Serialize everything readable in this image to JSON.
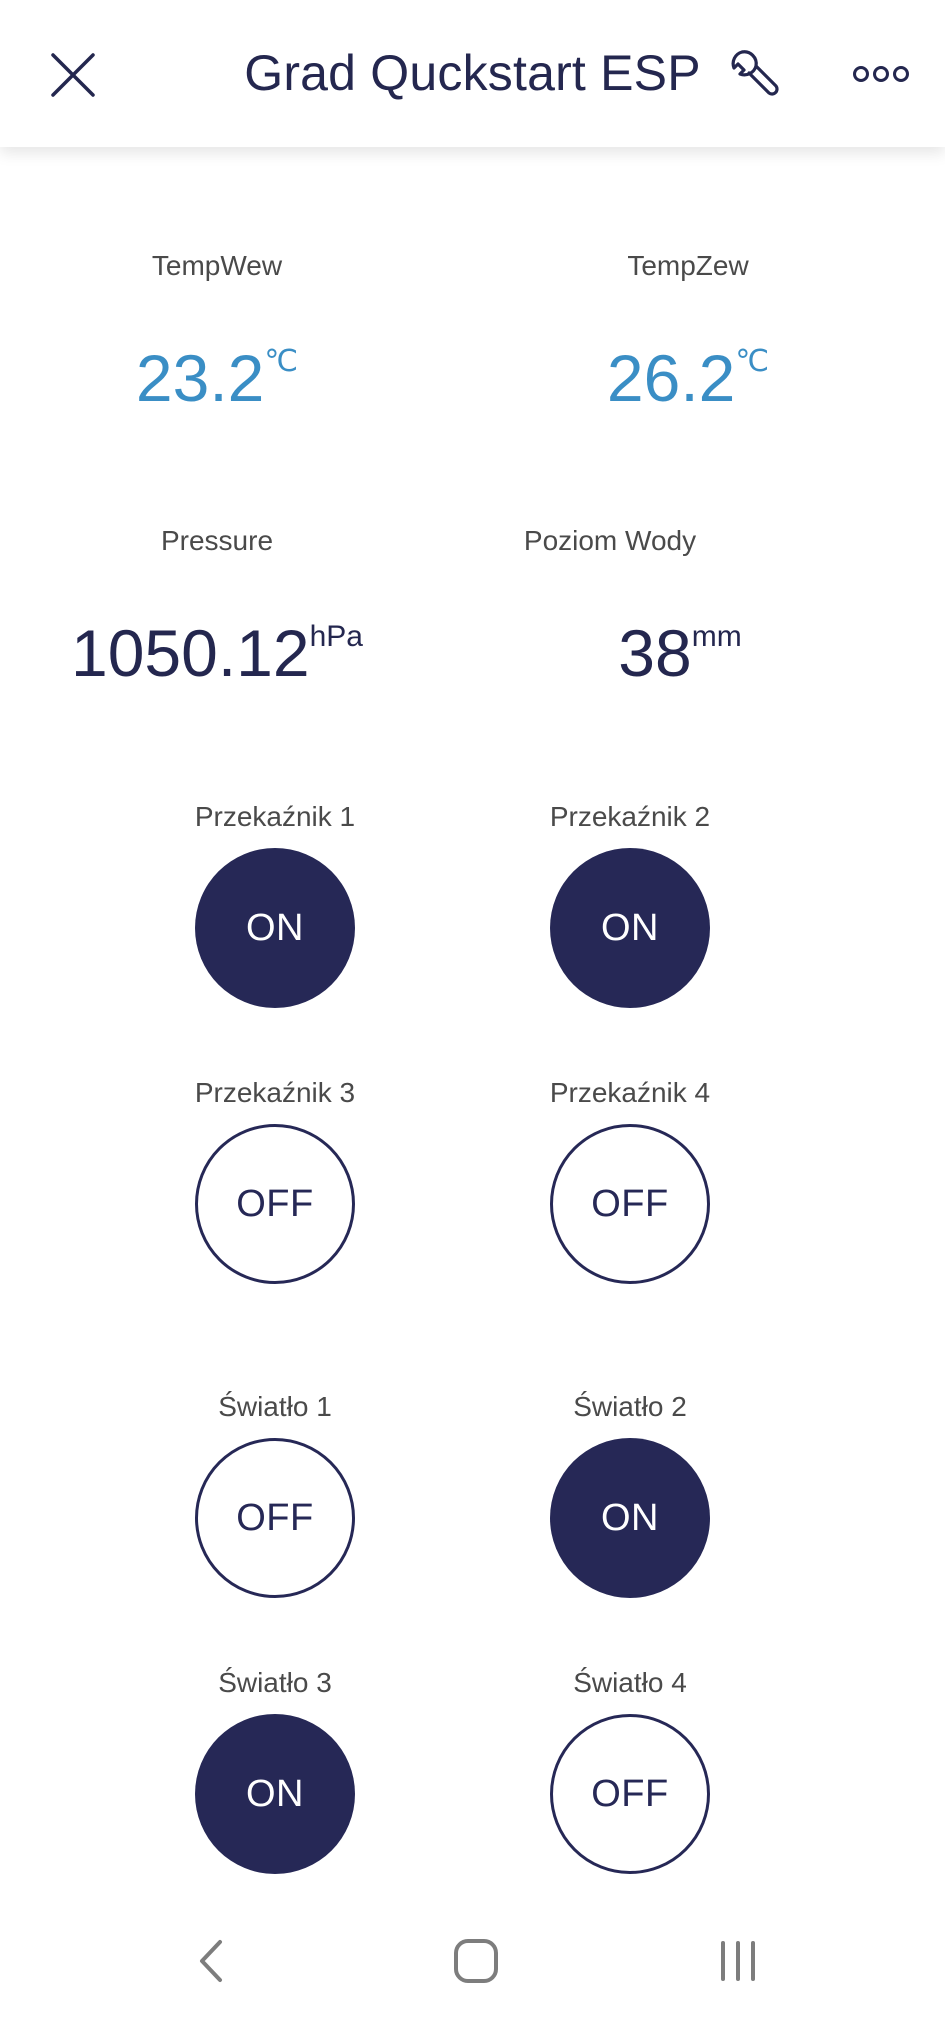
{
  "header": {
    "title": "Grad Quckstart ESP",
    "icons": [
      "close-icon",
      "wrench-icon",
      "more-dots-icon"
    ]
  },
  "sensors": [
    {
      "label": "TempWew",
      "value": "23.2",
      "unit": "℃"
    },
    {
      "label": "TempZew",
      "value": "26.2",
      "unit": "℃"
    },
    {
      "label": "Pressure",
      "value": "1050.12",
      "unit": "hPa"
    },
    {
      "label": "Poziom Wody",
      "value": "38",
      "unit": "mm"
    }
  ],
  "switches": [
    {
      "label": "Przekaźnik 1",
      "state": "ON"
    },
    {
      "label": "Przekaźnik 2",
      "state": "ON"
    },
    {
      "label": "Przekaźnik 3",
      "state": "OFF"
    },
    {
      "label": "Przekaźnik 4",
      "state": "OFF"
    },
    {
      "label": "Światło 1",
      "state": "OFF"
    },
    {
      "label": "Światło 2",
      "state": "ON"
    },
    {
      "label": "Światło 3",
      "state": "ON"
    },
    {
      "label": "Światło 4",
      "state": "OFF"
    }
  ],
  "colors": {
    "primary": "#262856",
    "temperature": "#3a8ec5",
    "label": "#4a4a4a",
    "background": "#ffffff"
  },
  "navbar": {
    "icons": [
      "back-icon",
      "home-icon",
      "recent-apps-icon"
    ]
  }
}
